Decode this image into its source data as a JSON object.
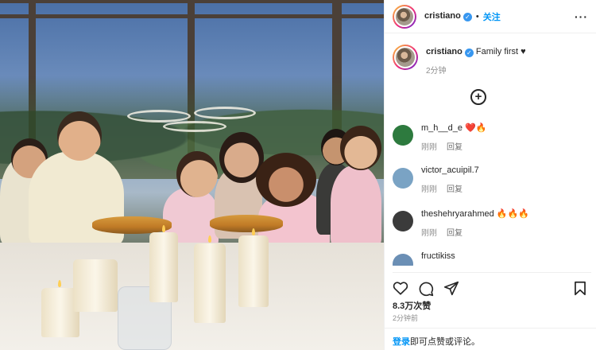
{
  "post": {
    "image_description_alt": "",
    "author": {
      "username": "cristiano",
      "verified": true,
      "follow_label": "关注",
      "more_icon": "more-horizontal-icon"
    },
    "caption": {
      "username": "cristiano",
      "text": "Family first",
      "emoji": "♥",
      "time": "2分钟"
    },
    "load_more_icon": "plus-circle-icon",
    "comments": [
      {
        "username": "m_h__d_e",
        "text": "❤️🔥",
        "time": "刚刚",
        "reply_label": "回复",
        "avatar_color": "#2d7a3e"
      },
      {
        "username": "victor_acuipil.7",
        "text": "",
        "time": "刚刚",
        "reply_label": "回复",
        "avatar_color": "#7aa3c4"
      },
      {
        "username": "theshehryarahmed",
        "text": "🔥🔥🔥",
        "time": "刚刚",
        "reply_label": "回复",
        "avatar_color": "#3b3b3b"
      },
      {
        "username": "fructikiss",
        "text": "",
        "time": "",
        "reply_label": "",
        "avatar_color": "#6b8fb5"
      }
    ],
    "actions": {
      "like_icon": "heart-icon",
      "comment_icon": "comment-icon",
      "share_icon": "send-icon",
      "save_icon": "bookmark-icon"
    },
    "likes": "8.3万次赞",
    "posted_ago": "2分钟前",
    "login_prompt": {
      "link": "登录",
      "text": "即可点赞或评论。"
    }
  }
}
